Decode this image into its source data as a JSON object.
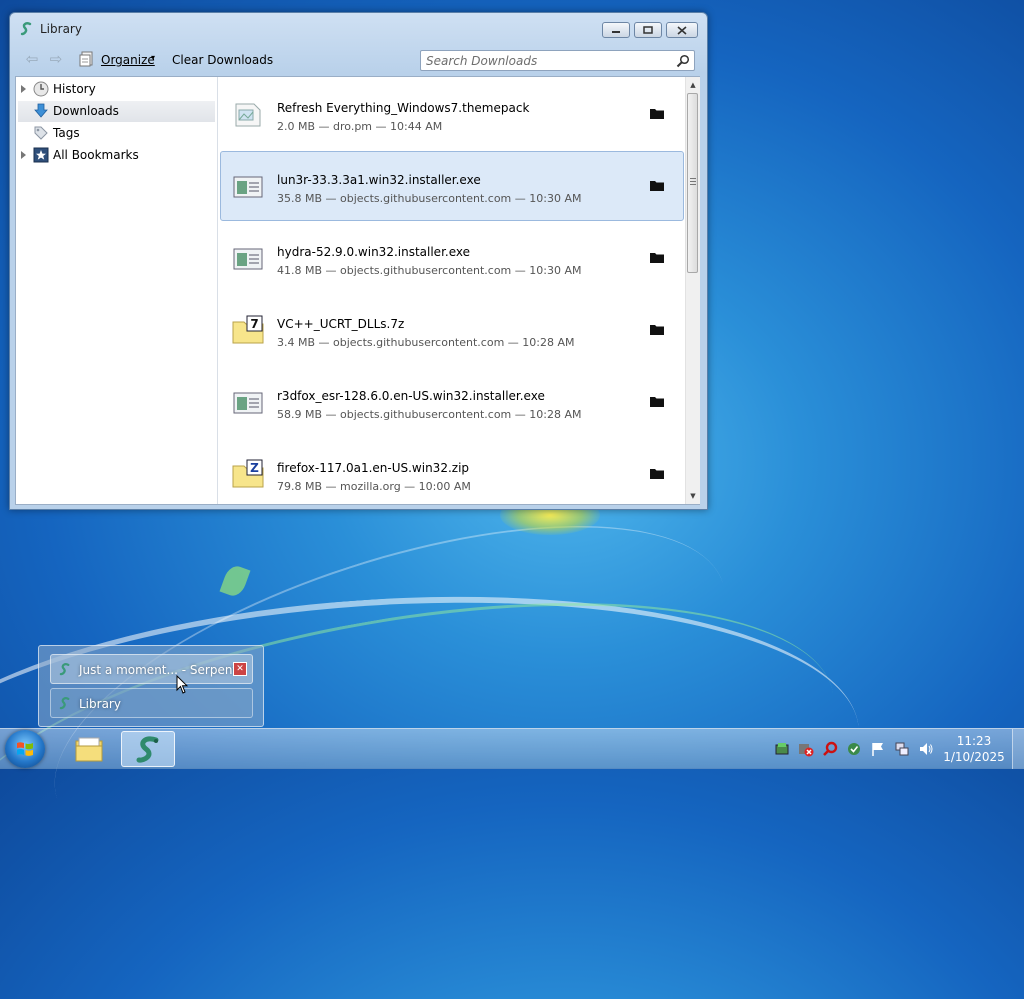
{
  "window": {
    "title": "Library",
    "controls": {
      "minimize": "minimize",
      "maximize": "maximize",
      "close": "close"
    }
  },
  "toolbar": {
    "organize_label": "Organize",
    "clear_label": "Clear Downloads",
    "search_placeholder": "Search Downloads"
  },
  "sidebar": {
    "items": [
      {
        "label": "History",
        "icon": "clock-icon",
        "expandable": true,
        "selected": false
      },
      {
        "label": "Downloads",
        "icon": "download-arrow-icon",
        "expandable": false,
        "selected": true
      },
      {
        "label": "Tags",
        "icon": "tag-icon",
        "expandable": false,
        "selected": false
      },
      {
        "label": "All Bookmarks",
        "icon": "bookmark-star-icon",
        "expandable": true,
        "selected": false
      }
    ]
  },
  "downloads": [
    {
      "name": "Refresh Everything_Windows7.themepack",
      "meta": "2.0 MB — dro.pm — 10:44 AM",
      "icon": "themepack-file-icon",
      "selected": false
    },
    {
      "name": "lun3r-33.3.3a1.win32.installer.exe",
      "meta": "35.8 MB — objects.githubusercontent.com — 10:30 AM",
      "icon": "exe-file-icon",
      "selected": true
    },
    {
      "name": "hydra-52.9.0.win32.installer.exe",
      "meta": "41.8 MB — objects.githubusercontent.com — 10:30 AM",
      "icon": "exe-file-icon",
      "selected": false
    },
    {
      "name": "VC++_UCRT_DLLs.7z",
      "meta": "3.4 MB — objects.githubusercontent.com — 10:28 AM",
      "icon": "7z-archive-icon",
      "selected": false
    },
    {
      "name": "r3dfox_esr-128.6.0.en-US.win32.installer.exe",
      "meta": "58.9 MB — objects.githubusercontent.com — 10:28 AM",
      "icon": "exe-file-icon",
      "selected": false
    },
    {
      "name": "firefox-117.0a1.en-US.win32.zip",
      "meta": "79.8 MB — mozilla.org — 10:00 AM",
      "icon": "zip-archive-icon",
      "selected": false
    }
  ],
  "popup": {
    "items": [
      {
        "label": "Just a moment... - Serpent",
        "has_close": true
      },
      {
        "label": "Library",
        "has_close": false
      }
    ]
  },
  "taskbar": {
    "clock_time": "11:23",
    "clock_date": "1/10/2025",
    "tray_icons": [
      "network-manager-icon",
      "security-alert-icon",
      "search-red-icon",
      "update-icon",
      "action-center-flag-icon",
      "network-icon",
      "volume-icon"
    ]
  },
  "colors": {
    "selection_bg": "#dce9f8",
    "selection_border": "#9bb9de",
    "desktop_blue": "#1565c0"
  }
}
